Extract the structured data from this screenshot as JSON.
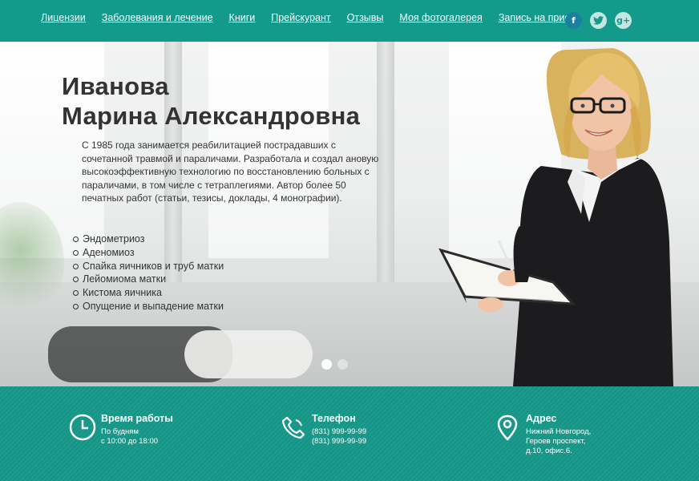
{
  "nav": {
    "items": [
      "Лицензии",
      "Заболевания и лечение",
      "Книги",
      "Прейскурант",
      "Отзывы",
      "Моя фотогалерея",
      "Запись на прием"
    ]
  },
  "social": {
    "facebook": "f",
    "twitter": "t",
    "google_plus": "g+"
  },
  "hero": {
    "name_line1": "Иванова",
    "name_line2": "Марина Александровна",
    "description": "С 1985 года занимается реабилитацией пострадавших с сочетанной травмой и параличами. Разработала и создал ановую высокоэффективную технологию по восстановлению больных с параличами, в том числе с тетраплегиями. Автор более 50 печатных работ (статьи, тезисы, доклады, 4 монографии).",
    "conditions": [
      "Эндометриоз",
      "Аденомиоз",
      "Спайка яичников и труб матки",
      "Лейомиома матки",
      "Кистома яичника",
      "Опущение и выпадение матки"
    ]
  },
  "footer": {
    "hours": {
      "title": "Время работы",
      "line1": "По будням",
      "line2": "с 10:00 до 18:00"
    },
    "phone": {
      "title": "Телефон",
      "line1": "(831) 999-99-99",
      "line2": "(831) 999-99-99"
    },
    "address": {
      "title": "Адрес",
      "line1": "Нижний Новгород,",
      "line2": "Героев проспект,",
      "line3": "д.10, офис.6."
    }
  },
  "colors": {
    "accent": "#139a8a",
    "footer": "#16998a",
    "text": "#333333"
  },
  "icons": [
    "facebook-icon",
    "twitter-icon",
    "google-plus-icon",
    "clock-icon",
    "phone-icon",
    "location-pin-icon"
  ]
}
